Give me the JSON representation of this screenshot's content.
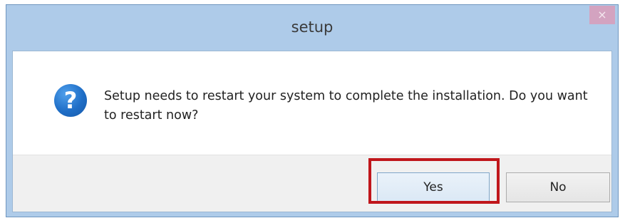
{
  "window": {
    "title": "setup",
    "close_glyph": "×"
  },
  "dialog": {
    "icon": "question-icon",
    "icon_glyph": "?",
    "message": "Setup needs to restart your system to complete the installation.  Do you want to restart now?"
  },
  "buttons": {
    "yes_label": "Yes",
    "no_label": "No"
  },
  "colors": {
    "titlebar": "#aecbe9",
    "highlight": "#c0161b"
  }
}
